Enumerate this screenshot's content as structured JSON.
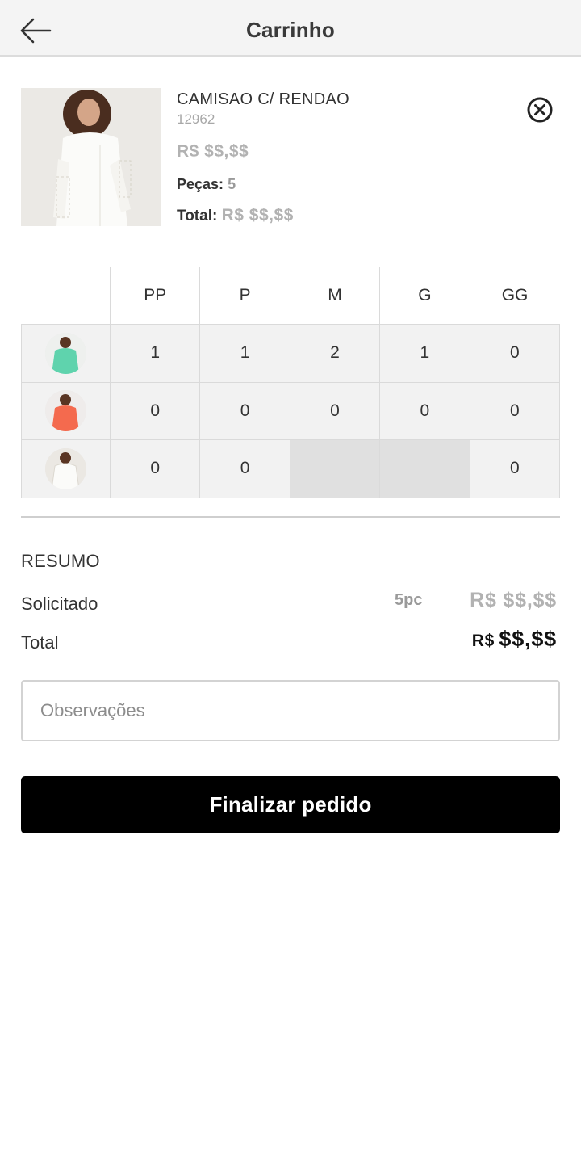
{
  "header": {
    "title": "Carrinho"
  },
  "product": {
    "name": "CAMISAO C/ RENDAO",
    "code": "12962",
    "price": "R$ $$,$$",
    "pieces_label": "Peças:",
    "pieces_value": "5",
    "total_label": "Total:",
    "total_value": "R$ $$,$$"
  },
  "grid": {
    "sizes": [
      "PP",
      "P",
      "M",
      "G",
      "GG"
    ],
    "rows": [
      {
        "color_icon": "green-shirt-thumbnail",
        "values": [
          "1",
          "1",
          "2",
          "1",
          "0"
        ]
      },
      {
        "color_icon": "coral-shirt-thumbnail",
        "values": [
          "0",
          "0",
          "0",
          "0",
          "0"
        ]
      },
      {
        "color_icon": "white-shirt-thumbnail",
        "values": [
          "0",
          "0",
          "",
          "",
          "0"
        ]
      }
    ]
  },
  "summary": {
    "title": "RESUMO",
    "requested_label": "Solicitado",
    "requested_qty": "5pc",
    "requested_price": "R$ $$,$$",
    "total_label": "Total",
    "total_currency": "R$",
    "total_amount": "$$,$$"
  },
  "notes": {
    "placeholder": "Observações"
  },
  "actions": {
    "finish_label": "Finalizar pedido"
  },
  "colors": {
    "accent": "#000000",
    "muted": "#b2b2b2",
    "header_bg": "#f4f4f4",
    "thumb_green": "#5fd3ad",
    "thumb_coral": "#f46a4e"
  }
}
